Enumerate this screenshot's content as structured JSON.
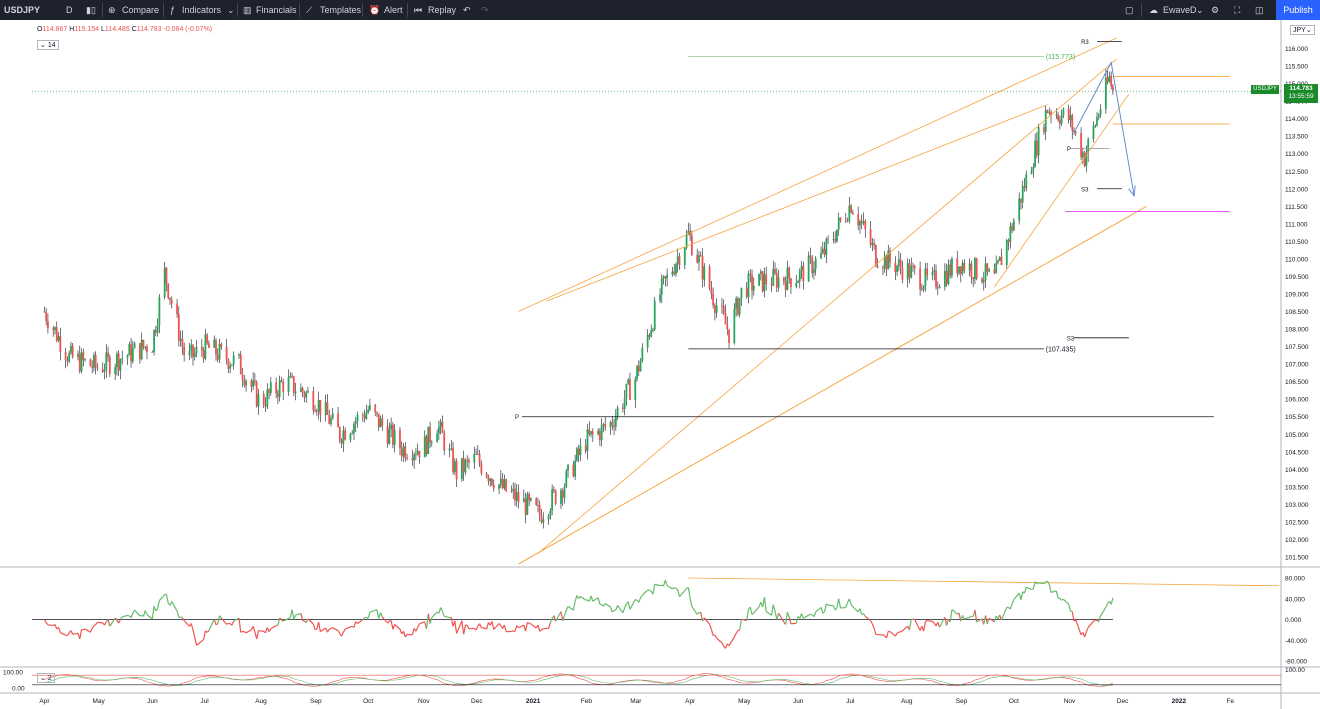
{
  "toolbar": {
    "symbol": "USDJPY",
    "interval": "D",
    "compare": "Compare",
    "indicators": "Indicators",
    "financials": "Financials",
    "templates": "Templates",
    "alert": "Alert",
    "replay": "Replay",
    "layout_name": "EwaveD",
    "publish": "Publish",
    "colors": {
      "bg": "#1e222d",
      "text": "#d1d4dc",
      "publish": "#2962ff"
    }
  },
  "legend": {
    "o": "114.867",
    "h": "115.154",
    "l": "114.485",
    "c": "114.783",
    "chg": "-0.084 (-0.07%)",
    "length": "14",
    "stoch_length": "2"
  },
  "price_axis": {
    "currency": "JPY",
    "last_symbol": "USDJPY",
    "last_price": "114.783",
    "countdown": "13:55:59"
  },
  "chart_data": {
    "type": "candlestick",
    "panes": [
      {
        "name": "price",
        "ylim": [
          101.5,
          116.2
        ],
        "y_ticks": [
          101.5,
          102,
          102.5,
          103,
          103.5,
          104,
          104.5,
          105,
          105.5,
          106,
          106.5,
          107,
          107.5,
          108,
          108.5,
          109,
          109.5,
          110,
          110.5,
          111,
          111.5,
          112,
          112.5,
          113,
          113.5,
          114,
          114.5,
          115,
          115.5,
          116
        ],
        "close_path": [
          [
            "2020-04-01",
            108.5
          ],
          [
            "2020-04-15",
            107.2
          ],
          [
            "2020-05-01",
            106.9
          ],
          [
            "2020-05-15",
            107.2
          ],
          [
            "2020-06-01",
            107.6
          ],
          [
            "2020-06-08",
            109.6
          ],
          [
            "2020-06-20",
            107.1
          ],
          [
            "2020-07-01",
            107.5
          ],
          [
            "2020-07-20",
            107.0
          ],
          [
            "2020-08-01",
            105.9
          ],
          [
            "2020-08-15",
            106.5
          ],
          [
            "2020-09-01",
            106.0
          ],
          [
            "2020-09-15",
            105.0
          ],
          [
            "2020-10-01",
            105.7
          ],
          [
            "2020-10-20",
            104.6
          ],
          [
            "2020-11-01",
            104.6
          ],
          [
            "2020-11-09",
            105.3
          ],
          [
            "2020-11-20",
            103.9
          ],
          [
            "2020-12-01",
            104.3
          ],
          [
            "2020-12-15",
            103.5
          ],
          [
            "2021-01-06",
            102.7
          ],
          [
            "2021-01-20",
            103.6
          ],
          [
            "2021-02-01",
            104.8
          ],
          [
            "2021-02-15",
            105.3
          ],
          [
            "2021-03-01",
            106.6
          ],
          [
            "2021-03-15",
            109.0
          ],
          [
            "2021-03-31",
            110.7
          ],
          [
            "2021-04-15",
            108.8
          ],
          [
            "2021-04-23",
            107.9
          ],
          [
            "2021-05-01",
            109.2
          ],
          [
            "2021-05-15",
            109.4
          ],
          [
            "2021-06-01",
            109.5
          ],
          [
            "2021-06-15",
            110.1
          ],
          [
            "2021-07-01",
            111.6
          ],
          [
            "2021-07-15",
            110.1
          ],
          [
            "2021-08-01",
            109.7
          ],
          [
            "2021-08-15",
            109.3
          ],
          [
            "2021-09-01",
            109.9
          ],
          [
            "2021-09-20",
            109.4
          ],
          [
            "2021-10-01",
            111.1
          ],
          [
            "2021-10-20",
            114.3
          ],
          [
            "2021-11-01",
            114.0
          ],
          [
            "2021-11-10",
            112.9
          ],
          [
            "2021-11-24",
            115.15
          ],
          [
            "2021-11-26",
            114.78
          ]
        ],
        "levels": [
          {
            "label": "(115.773)",
            "value": 115.773
          },
          {
            "label": "(107.435)",
            "value": 107.435
          },
          {
            "label": "R3",
            "value": 116.2
          },
          {
            "label": "P",
            "value": 113.1
          },
          {
            "label": "S3",
            "value": 112.0
          },
          {
            "label": "S3",
            "value": 107.7
          },
          {
            "label": "P",
            "value": 105.5
          }
        ],
        "last": 114.783
      },
      {
        "name": "oscillator",
        "ylim": [
          -80,
          80
        ],
        "y_ticks": [
          "80.000",
          "40.000",
          "0.000",
          "-40.000",
          "-80.000"
        ]
      },
      {
        "name": "stochastic",
        "y_ticks": [
          "100.00",
          "0.00"
        ]
      }
    ],
    "x_labels": [
      "Apr",
      "May",
      "Jun",
      "Jul",
      "Aug",
      "Sep",
      "Oct",
      "Nov",
      "Dec",
      "2021",
      "Feb",
      "Mar",
      "Apr",
      "May",
      "Jun",
      "Jul",
      "Aug",
      "Sep",
      "Oct",
      "Nov",
      "Dec",
      "2022",
      "Fe"
    ],
    "colors": {
      "up": "#26a65b",
      "down": "#ef5350",
      "channel": "#f7a440",
      "projection": "#5b7fc7"
    }
  }
}
